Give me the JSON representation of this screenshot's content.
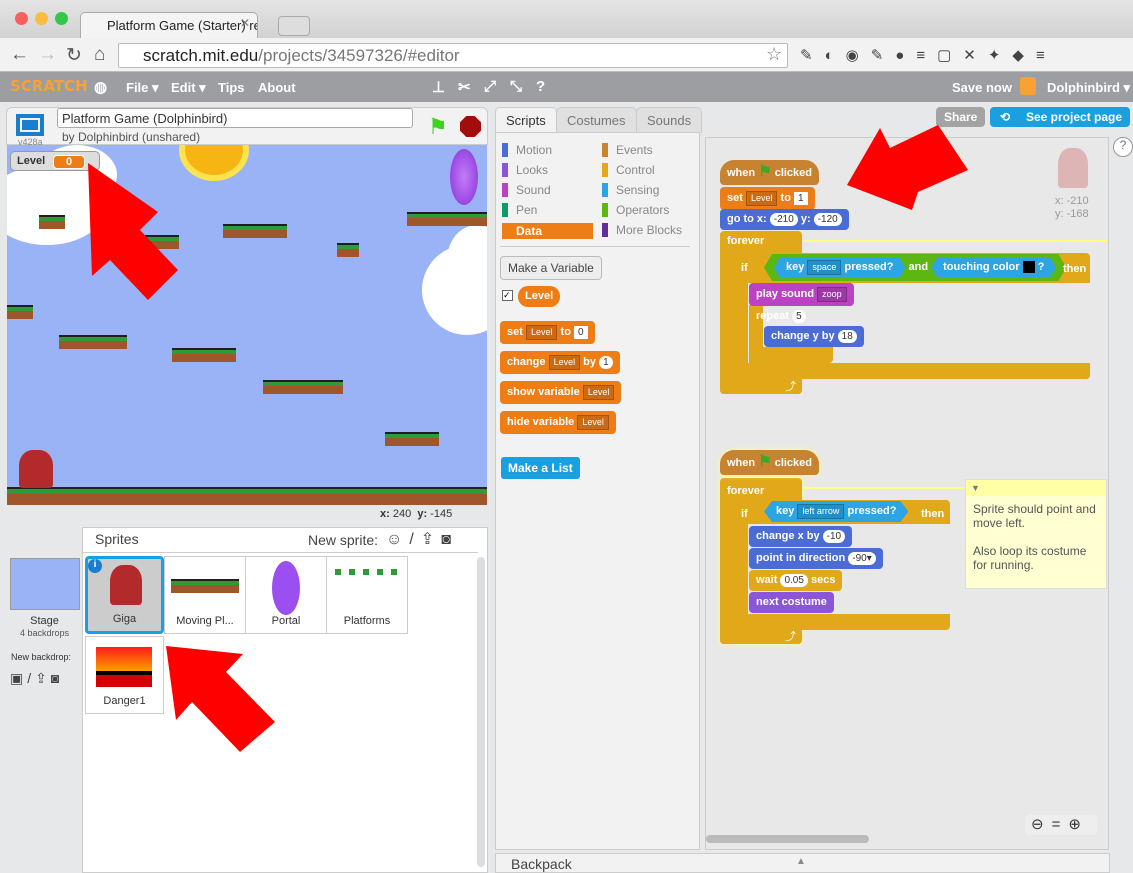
{
  "browser": {
    "tab_title": "Platform Game (Starter) rer",
    "url_host": "scratch.mit.edu",
    "url_path": "/projects/34597326/#editor"
  },
  "menu": {
    "logo": "SCRATCH",
    "items": [
      "File ▾",
      "Edit ▾",
      "Tips",
      "About"
    ],
    "save_now": "Save now",
    "user": "Dolphinbird ▾"
  },
  "stage": {
    "version": "v428a",
    "project_title": "Platform Game (Dolphinbird)",
    "byline": "by Dolphinbird (unshared)",
    "variable_label": "Level",
    "variable_value": "0",
    "x_label": "x:",
    "x": "240",
    "y_label": "y:",
    "y": "-145"
  },
  "sprites": {
    "header": "Sprites",
    "new_sprite": "New sprite:",
    "stage_label": "Stage",
    "stage_backdrops": "4 backdrops",
    "new_backdrop": "New backdrop:",
    "items": [
      "Giga",
      "Moving Pl...",
      "Portal",
      "Platforms",
      "Danger1"
    ]
  },
  "tabs": [
    "Scripts",
    "Costumes",
    "Sounds"
  ],
  "top_buttons": {
    "share": "Share",
    "see_project": "See project page"
  },
  "palette": {
    "categories_left": [
      "Motion",
      "Looks",
      "Sound",
      "Pen",
      "Data"
    ],
    "categories_right": [
      "Events",
      "Control",
      "Sensing",
      "Operators",
      "More Blocks"
    ],
    "make_variable": "Make a Variable",
    "variable": "Level",
    "blocks": {
      "set": "set",
      "to": "to",
      "set_val": "0",
      "change": "change",
      "by": "by",
      "change_val": "1",
      "show_var": "show variable",
      "hide_var": "hide variable",
      "var": "Level"
    },
    "make_list": "Make a List"
  },
  "script_area": {
    "sprite_x": "x: -210",
    "sprite_y": "y: -168",
    "s1": {
      "when": "when",
      "clicked": "clicked",
      "set": "set",
      "var": "Level",
      "to": "to",
      "val": "1",
      "goto": "go to x:",
      "gx": "-210",
      "gy_label": "y:",
      "gy": "-120",
      "forever": "forever",
      "if": "if",
      "key": "key",
      "key_val": "space",
      "pressed": "pressed?",
      "and": "and",
      "touching": "touching color",
      "q": "?",
      "then": "then",
      "play": "play sound",
      "sound": "zoop",
      "repeat": "repeat",
      "rep_val": "5",
      "changey": "change y by",
      "cy": "18"
    },
    "s2": {
      "when": "when",
      "clicked": "clicked",
      "forever": "forever",
      "if": "if",
      "key": "key",
      "key_val": "left arrow",
      "pressed": "pressed?",
      "then": "then",
      "changex": "change x by",
      "cx": "-10",
      "point": "point in direction",
      "dir": "-90▾",
      "wait": "wait",
      "wait_val": "0.05",
      "secs": "secs",
      "next": "next costume"
    },
    "comment": [
      "Sprite should point and move left.",
      "Also loop its costume for running."
    ]
  },
  "backpack": "Backpack",
  "colors": {
    "arrow": "#ff0000",
    "events": "#c88330",
    "control": "#e1a91a",
    "motion": "#4a6cd4",
    "data": "#ee7d16",
    "sensing": "#2ca5e2",
    "sound": "#bb42c3",
    "looks": "#8a55d7",
    "operators": "#5cb712"
  }
}
